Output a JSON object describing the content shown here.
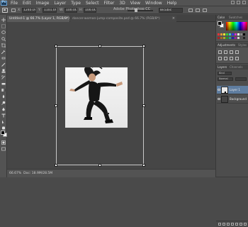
{
  "app": {
    "title": "Adobe Photoshop CC",
    "logo_text": "Ps",
    "menu": [
      "File",
      "Edit",
      "Image",
      "Layer",
      "Type",
      "Select",
      "Filter",
      "3D",
      "View",
      "Window",
      "Help"
    ]
  },
  "options_bar": {
    "x_value": "1240.00 px",
    "y_value": "1101.00 px",
    "w_value": "100.00%",
    "h_value": "100.00%",
    "angle_value": "0.00",
    "h_skew": "0.00",
    "v_skew": "0.00",
    "interpolation": "Bicubic"
  },
  "tabs": [
    {
      "label": "Untitled-1 @ 66.7% (Layer 1, RGB/8*)",
      "active": true
    },
    {
      "label": "dancer-woman-jump-composite.psd @ 66.7% (RGB/8*)",
      "active": false
    }
  ],
  "status": {
    "zoom": "66.67%",
    "doc": "Doc: 18.9M/28.5M"
  },
  "panels": {
    "color_tab": "Color",
    "swatches_tab": "Swatches",
    "adjustments_tab": "Adjustments",
    "styles_tab": "Styles",
    "layers_tab": "Layers",
    "channels_tab": "Channels",
    "kind_label": "Kind",
    "blend_mode": "Normal",
    "layers": [
      {
        "name": "Layer 1",
        "selected": true
      },
      {
        "name": "Background",
        "selected": false
      }
    ]
  },
  "colors": {
    "accent": "#5f7da0",
    "ui_dark": "#464646",
    "ui_mid": "#535353"
  }
}
